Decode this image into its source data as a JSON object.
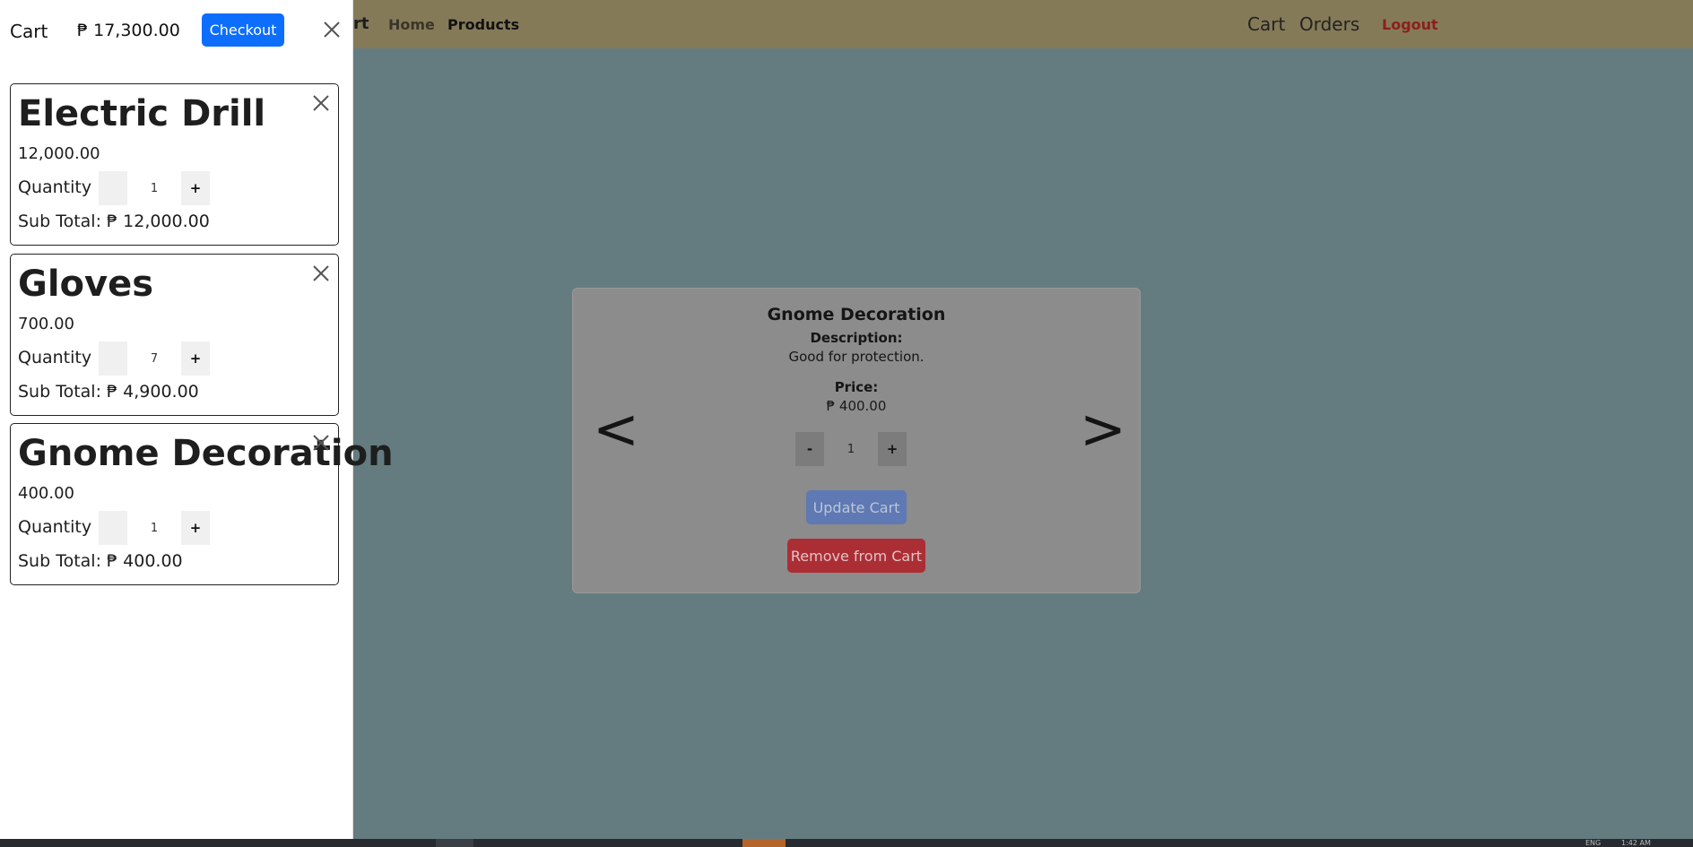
{
  "navbar": {
    "brand_fragment": "rt",
    "links": [
      "Home",
      "Products"
    ],
    "right_links": [
      "Cart",
      "Orders"
    ],
    "logout": "Logout"
  },
  "product_card": {
    "title": "Gnome Decoration",
    "description_label": "Description:",
    "description": "Good for protection.",
    "price_label": "Price:",
    "price": "₱ 400.00",
    "quantity": "1",
    "minus": "-",
    "plus": "+",
    "update_label": "Update Cart",
    "remove_label": "Remove from Cart",
    "prev": "<",
    "next": ">"
  },
  "cart": {
    "title": "Cart",
    "total": "₱ 17,300.00",
    "checkout_label": "Checkout",
    "items": [
      {
        "name": "Electric Drill",
        "price": "12,000.00",
        "quantity_label": "Quantity",
        "quantity": "1",
        "plus": "+",
        "subtotal": "Sub Total: ₱ 12,000.00"
      },
      {
        "name": "Gloves",
        "price": "700.00",
        "quantity_label": "Quantity",
        "quantity": "7",
        "plus": "+",
        "subtotal": "Sub Total: ₱ 4,900.00"
      },
      {
        "name": "Gnome Decoration",
        "price": "400.00",
        "quantity_label": "Quantity",
        "quantity": "1",
        "plus": "+",
        "subtotal": "Sub Total: ₱ 400.00"
      }
    ]
  },
  "taskbar": {
    "lang": "ENG",
    "time": "1:42 AM"
  },
  "colors": {
    "navbar": "#857a58",
    "backdrop": "#647c80",
    "primary": "#0d6efd",
    "danger": "#ac2e35"
  },
  "icons": [
    "close-icon",
    "remove-item-icon"
  ]
}
